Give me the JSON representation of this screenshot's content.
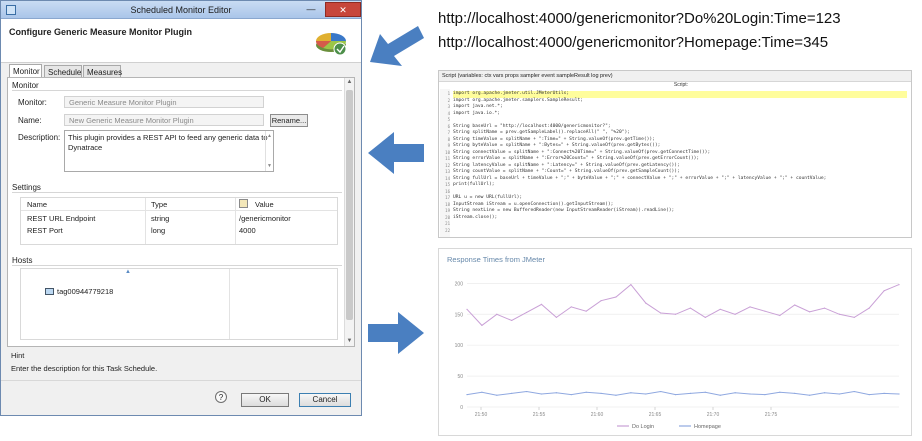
{
  "window": {
    "title": "Scheduled Monitor Editor",
    "minimize_glyph": "—",
    "close_glyph": "✕",
    "header_title": "Configure Generic Measure Monitor Plugin",
    "tabs": [
      "Monitor",
      "Schedule",
      "Measures"
    ],
    "monitor_section": "Monitor",
    "monitor_label": "Monitor:",
    "monitor_value": "Generic Measure Monitor Plugin",
    "name_label": "Name:",
    "name_value": "New Generic Measure Monitor Plugin",
    "rename_label": "Rename...",
    "description_label": "Description:",
    "description_value": "This plugin provides a REST API to feed any generic data to Dynatrace",
    "settings_section": "Settings",
    "settings_headers": [
      "Name",
      "Type",
      "Value"
    ],
    "settings_rows": [
      {
        "name": "REST URL Endpoint",
        "type": "string",
        "value": "/genericmonitor"
      },
      {
        "name": "REST Port",
        "type": "long",
        "value": "4000"
      }
    ],
    "hosts_section": "Hosts",
    "host_item": "tag00944779218",
    "hint_title": "Hint",
    "hint_text": "Enter the description for this Task Schedule.",
    "help_glyph": "?",
    "ok_label": "OK",
    "cancel_label": "Cancel"
  },
  "urls": [
    "http://localhost:4000/genericmonitor?Do%20Login:Time=123",
    "http://localhost:4000/genericmonitor?Homepage:Time=345"
  ],
  "script": {
    "header": "Script (variables: ctx vars props sampler event sampleResult log prev)",
    "subheader": "Script:",
    "line_numbers": [
      "1",
      "2",
      "3",
      "4",
      "5",
      "6",
      "7",
      "8",
      "9",
      "10",
      "11",
      "12",
      "13",
      "14",
      "15",
      "16",
      "17",
      "18",
      "19",
      "20",
      "21",
      "22"
    ],
    "lines": [
      "import org.apache.jmeter.util.JMeterUtils;",
      "import org.apache.jmeter.samplers.SampleResult;",
      "import java.net.*;",
      "import java.io.*;",
      "",
      "String baseUrl = \"http://localhost:4000/genericmonitor?\";",
      "String splitName = prev.getSampleLabel().replaceAll(\" \", \"%20\");",
      "String timeValue = splitName + \":Time=\" + String.valueOf(prev.getTime());",
      "String byteValue = splitName + \":Bytes=\" + String.valueOf(prev.getBytes());",
      "String connectValue = splitName + \":Connect%20Time=\" + String.valueOf(prev.getConnectTime());",
      "String errorValue = splitName + \":Error%20Count=\" + String.valueOf(prev.getErrorCount());",
      "String latencyValue = splitName + \":Latency=\" + String.valueOf(prev.getLatency());",
      "String countValue = splitName + \":Count=\" + String.valueOf(prev.getSampleCount());",
      "String fullUrl = baseUrl + timeValue + \";\" + byteValue + \";\" + connectValue + \";\" + errorValue + \";\" + latencyValue + \";\" + countValue;",
      "print(fullUrl);",
      "",
      "URL u = new URL(fullUrl);",
      "InputStream iStream = u.openConnection().getInputStream();",
      "String nextLine = new BufferedReader(new InputStreamReader(iStream)).readLine();",
      "iStream.close();",
      "",
      ""
    ]
  },
  "chart_data": {
    "type": "line",
    "title": "Response Times from JMeter",
    "xlabel": "",
    "ylabel": "",
    "x": [
      "21:50",
      "21:51",
      "21:52",
      "21:53",
      "21:54",
      "21:55",
      "21:56",
      "21:57",
      "21:58",
      "21:59",
      "22:00",
      "22:01",
      "22:02",
      "22:03",
      "22:04",
      "22:05",
      "22:06",
      "22:07",
      "22:08",
      "22:09",
      "22:10",
      "22:11",
      "22:12",
      "22:13",
      "22:14",
      "22:15",
      "22:16",
      "22:17",
      "22:18",
      "22:19"
    ],
    "x_ticks": [
      "21:50",
      "21:55",
      "21:60",
      "21:65",
      "21:70",
      "21:75"
    ],
    "y_ticks": [
      0,
      50,
      100,
      150,
      200
    ],
    "ylim": [
      0,
      220
    ],
    "grid": true,
    "legend_position": "bottom",
    "series": [
      {
        "name": "Do Login",
        "color": "#c9a0d6",
        "values": [
          158,
          132,
          150,
          140,
          153,
          166,
          145,
          162,
          155,
          172,
          178,
          198,
          168,
          152,
          150,
          160,
          145,
          158,
          150,
          162,
          155,
          148,
          165,
          154,
          160,
          150,
          145,
          160,
          188,
          198
        ]
      },
      {
        "name": "Homepage",
        "color": "#8fa8e0",
        "values": [
          20,
          24,
          19,
          22,
          25,
          21,
          23,
          20,
          24,
          22,
          19,
          23,
          21,
          25,
          20,
          22,
          24,
          19,
          23,
          21,
          20,
          24,
          22,
          19,
          23,
          21,
          25,
          20,
          22,
          21
        ]
      }
    ]
  },
  "icons": {
    "app_icon": "window-app-icon",
    "plugin_icon": "pie-chart-icon",
    "value_header_icon": "table-icon",
    "host_icon": "monitor-icon"
  },
  "colors": {
    "arrow": "#4a7fc1",
    "title_bar": "#b9d1ee",
    "close": "#c7463b"
  }
}
